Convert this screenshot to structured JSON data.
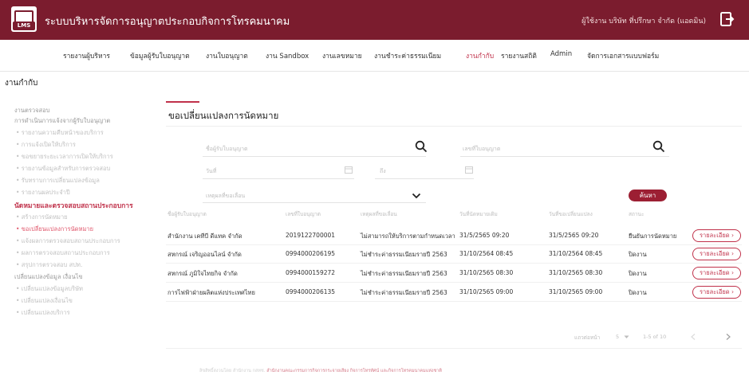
{
  "app": {
    "title": "ระบบบริหารจัดการอนุญาตประกอบกิจการโทรคมนาคม",
    "logo_text": "LMS",
    "user": "ผู้ใช้งาน บริษัท ที่ปรึกษา จำกัด (แอดมิน)"
  },
  "nav": {
    "items": [
      {
        "label": "รายงานผู้บริหาร",
        "active": false
      },
      {
        "label": "ข้อมูลผู้รับใบอนุญาต",
        "active": false
      },
      {
        "label": "งานใบอนุญาต",
        "active": false
      },
      {
        "label": "งาน Sandbox",
        "active": false
      },
      {
        "label": "งานเลขหมาย",
        "active": false
      },
      {
        "label": "งานชำระค่าธรรมเนียม",
        "active": false
      },
      {
        "label": "งานกำกับ",
        "active": true
      },
      {
        "label": "รายงานสถิติ",
        "active": false
      },
      {
        "label": "Admin",
        "active": false
      },
      {
        "label": "จัดการเอกสารแบบฟอร์ม",
        "active": false
      }
    ]
  },
  "section_title": "งานกำกับ",
  "sidebar": {
    "items": [
      {
        "label": "งานตรวจสอบ",
        "type": "head"
      },
      {
        "label": "การดำเนินการแจ้งจากผู้รับใบอนุญาต",
        "type": "head"
      },
      {
        "label": "• รายงานความคืบหน้าของบริการ",
        "type": "item"
      },
      {
        "label": "• การแจ้งเปิดให้บริการ",
        "type": "item"
      },
      {
        "label": "• ขอขยายระยะเวลาการเปิดให้บริการ",
        "type": "item"
      },
      {
        "label": "• รายงานข้อมูลสำหรับการตรวจสอบ",
        "type": "item"
      },
      {
        "label": "• รับทราบการเปลี่ยนแปลงข้อมูล",
        "type": "item"
      },
      {
        "label": "• รายงานผลประจำปี",
        "type": "item"
      },
      {
        "label": "นัดหมายและตรวจสอบสถานประกอบการ",
        "type": "head-strong"
      },
      {
        "label": "• สร้างการนัดหมาย",
        "type": "item"
      },
      {
        "label": "• ขอเปลี่ยนแปลงการนัดหมาย",
        "type": "active"
      },
      {
        "label": "• แจ้งผลการตรวจสอบสถานประกอบการ",
        "type": "item"
      },
      {
        "label": "• ผลการตรวจสอบสถานประกอบการ",
        "type": "item"
      },
      {
        "label": "• สรุปการตรวจสอบ สปท.",
        "type": "item"
      },
      {
        "label": "เปลี่ยนแปลงข้อมูล เงื่อนไข",
        "type": "head"
      },
      {
        "label": "• เปลี่ยนแปลงข้อมูลบริษัท",
        "type": "item"
      },
      {
        "label": "• เปลี่ยนแปลงเงื่อนไข",
        "type": "item"
      },
      {
        "label": "• เปลี่ยนแปลงบริการ",
        "type": "item"
      }
    ]
  },
  "card": {
    "title": "ขอเปลี่ยนแปลงการนัดหมาย"
  },
  "filters": {
    "licensee_label": "ชื่อผู้รับใบอนุญาต",
    "license_no_label": "เลขที่ใบอนุญาต",
    "date_label": "วันที่",
    "to_label": "ถึง",
    "reason_label": "เหตุผลที่ขอเลื่อน",
    "search_button": "ค้นหา"
  },
  "table": {
    "headers": [
      "ชื่อผู้รับใบอนุญาต",
      "เลขที่ใบอนุญาต",
      "เหตุผลที่ขอเลื่อน",
      "วันที่นัดหมายเดิม",
      "วันที่ขอเปลี่ยนแปลง",
      "สถานะ"
    ],
    "rows": [
      [
        "สำนักงาน เคทีบี ดีแทค จำกัด",
        "2019122700001",
        "ไม่สามารถให้บริการตามกำหนดเวลา",
        "31/5/2565 09:20",
        "31/5/2565 09:20",
        "ยืนยันการนัดหมาย"
      ],
      [
        "สหกรณ์ เจริญออนไลน์ จำกัด",
        "0994000206195",
        "ไม่ชำระค่าธรรมเนียมรายปี 2563",
        "31/10/2564 08:45",
        "31/10/2564 08:45",
        "ปิดงาน"
      ],
      [
        "สหกรณ์ ภูมิใจไทยกิจ จำกัด",
        "0994000159272",
        "ไม่ชำระค่าธรรมเนียมรายปี 2563",
        "31/10/2565 08:30",
        "31/10/2565 08:30",
        "ปิดงาน"
      ],
      [
        "การไฟฟ้าฝ่ายผลิตแห่งประเทศไทย",
        "0994000206135",
        "ไม่ชำระค่าธรรมเนียมรายปี 2563",
        "31/10/2565 09:00",
        "31/10/2565 09:00",
        "ปิดงาน"
      ]
    ],
    "detail_button": "รายละเอียด ›"
  },
  "pagination": {
    "rows_per_page_label": "แถวต่อหน้า",
    "rows_per_page": "5",
    "range": "1-5 of 10"
  },
  "footer": {
    "text": "สำนักงานคณะกรรมการกิจการกระจายเสียง กิจการโทรทัศน์ และกิจการโทรคมนาคมแห่งชาติ",
    "highlight": "ลิขสิทธิ์สงวนโดย สำนักงาน กสทช."
  },
  "colors": {
    "brand": "#7b1c2e",
    "accent": "#c0314a"
  }
}
